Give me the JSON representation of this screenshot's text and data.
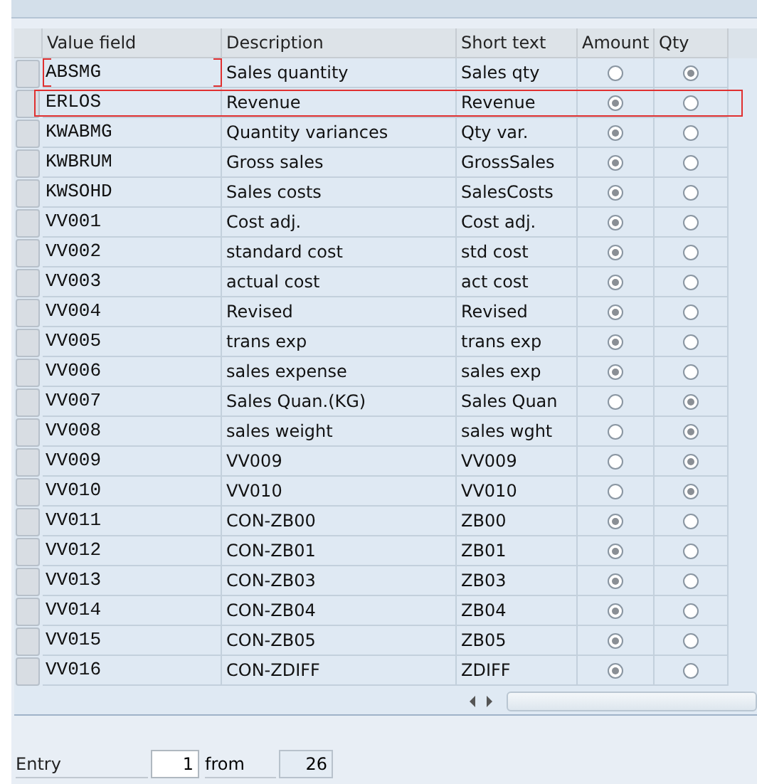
{
  "table": {
    "columns": [
      "Value field",
      "Description",
      "Short text",
      "Amount",
      "Qty"
    ],
    "rows": [
      {
        "value_field": "ABSMG",
        "description": "Sales quantity",
        "short_text": "Sales qty",
        "amount": false,
        "qty": true,
        "focused": true,
        "selected": false
      },
      {
        "value_field": "ERLOS",
        "description": "Revenue",
        "short_text": "Revenue",
        "amount": true,
        "qty": false,
        "focused": false,
        "selected": true
      },
      {
        "value_field": "KWABMG",
        "description": "Quantity variances",
        "short_text": "Qty var.",
        "amount": true,
        "qty": false,
        "focused": false,
        "selected": false
      },
      {
        "value_field": "KWBRUM",
        "description": "Gross sales",
        "short_text": "GrossSales",
        "amount": true,
        "qty": false,
        "focused": false,
        "selected": false
      },
      {
        "value_field": "KWSOHD",
        "description": "Sales costs",
        "short_text": "SalesCosts",
        "amount": true,
        "qty": false,
        "focused": false,
        "selected": false
      },
      {
        "value_field": "VV001",
        "description": "Cost adj.",
        "short_text": "Cost adj.",
        "amount": true,
        "qty": false,
        "focused": false,
        "selected": false
      },
      {
        "value_field": "VV002",
        "description": "standard cost",
        "short_text": "std cost",
        "amount": true,
        "qty": false,
        "focused": false,
        "selected": false
      },
      {
        "value_field": "VV003",
        "description": "actual cost",
        "short_text": "act cost",
        "amount": true,
        "qty": false,
        "focused": false,
        "selected": false
      },
      {
        "value_field": "VV004",
        "description": "Revised",
        "short_text": "Revised",
        "amount": true,
        "qty": false,
        "focused": false,
        "selected": false
      },
      {
        "value_field": "VV005",
        "description": "trans exp",
        "short_text": "trans exp",
        "amount": true,
        "qty": false,
        "focused": false,
        "selected": false
      },
      {
        "value_field": "VV006",
        "description": "sales expense",
        "short_text": "sales exp",
        "amount": true,
        "qty": false,
        "focused": false,
        "selected": false
      },
      {
        "value_field": "VV007",
        "description": "Sales Quan.(KG)",
        "short_text": "Sales Quan",
        "amount": false,
        "qty": true,
        "focused": false,
        "selected": false
      },
      {
        "value_field": "VV008",
        "description": "sales weight",
        "short_text": "sales wght",
        "amount": false,
        "qty": true,
        "focused": false,
        "selected": false
      },
      {
        "value_field": "VV009",
        "description": "VV009",
        "short_text": "VV009",
        "amount": false,
        "qty": true,
        "focused": false,
        "selected": false
      },
      {
        "value_field": "VV010",
        "description": "VV010",
        "short_text": "VV010",
        "amount": false,
        "qty": true,
        "focused": false,
        "selected": false
      },
      {
        "value_field": "VV011",
        "description": "CON-ZB00",
        "short_text": "ZB00",
        "amount": true,
        "qty": false,
        "focused": false,
        "selected": false
      },
      {
        "value_field": "VV012",
        "description": "CON-ZB01",
        "short_text": "ZB01",
        "amount": true,
        "qty": false,
        "focused": false,
        "selected": false
      },
      {
        "value_field": "VV013",
        "description": "CON-ZB03",
        "short_text": "ZB03",
        "amount": true,
        "qty": false,
        "focused": false,
        "selected": false
      },
      {
        "value_field": "VV014",
        "description": "CON-ZB04",
        "short_text": "ZB04",
        "amount": true,
        "qty": false,
        "focused": false,
        "selected": false
      },
      {
        "value_field": "VV015",
        "description": "CON-ZB05",
        "short_text": "ZB05",
        "amount": true,
        "qty": false,
        "focused": false,
        "selected": false
      },
      {
        "value_field": "VV016",
        "description": "CON-ZDIFF",
        "short_text": "ZDIFF",
        "amount": true,
        "qty": false,
        "focused": false,
        "selected": false
      }
    ]
  },
  "footer": {
    "entry_label": "Entry",
    "entry_value": "1",
    "from_label": "from",
    "total": "26"
  }
}
